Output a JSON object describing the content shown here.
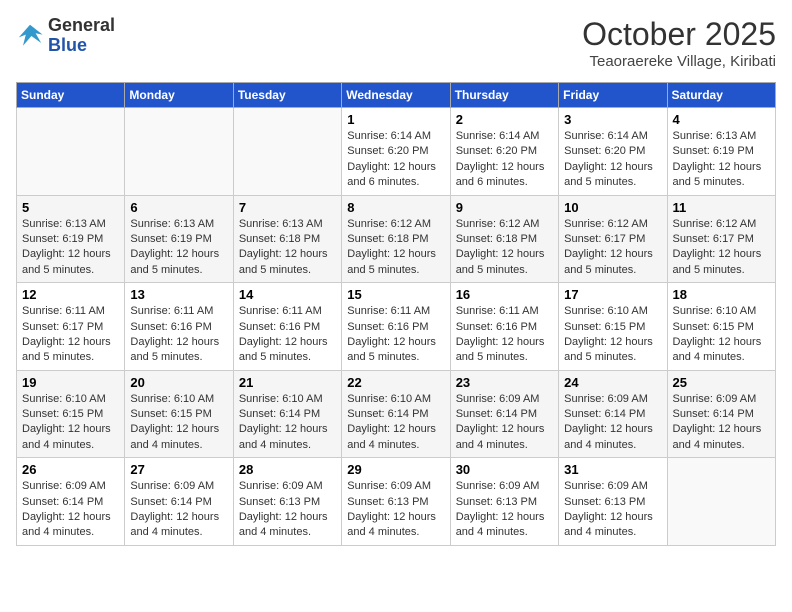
{
  "header": {
    "logo_general": "General",
    "logo_blue": "Blue",
    "month_title": "October 2025",
    "subtitle": "Teaoraereke Village, Kiribati"
  },
  "weekdays": [
    "Sunday",
    "Monday",
    "Tuesday",
    "Wednesday",
    "Thursday",
    "Friday",
    "Saturday"
  ],
  "weeks": [
    [
      {
        "day": "",
        "info": ""
      },
      {
        "day": "",
        "info": ""
      },
      {
        "day": "",
        "info": ""
      },
      {
        "day": "1",
        "info": "Sunrise: 6:14 AM\nSunset: 6:20 PM\nDaylight: 12 hours and 6 minutes."
      },
      {
        "day": "2",
        "info": "Sunrise: 6:14 AM\nSunset: 6:20 PM\nDaylight: 12 hours and 6 minutes."
      },
      {
        "day": "3",
        "info": "Sunrise: 6:14 AM\nSunset: 6:20 PM\nDaylight: 12 hours and 5 minutes."
      },
      {
        "day": "4",
        "info": "Sunrise: 6:13 AM\nSunset: 6:19 PM\nDaylight: 12 hours and 5 minutes."
      }
    ],
    [
      {
        "day": "5",
        "info": "Sunrise: 6:13 AM\nSunset: 6:19 PM\nDaylight: 12 hours and 5 minutes."
      },
      {
        "day": "6",
        "info": "Sunrise: 6:13 AM\nSunset: 6:19 PM\nDaylight: 12 hours and 5 minutes."
      },
      {
        "day": "7",
        "info": "Sunrise: 6:13 AM\nSunset: 6:18 PM\nDaylight: 12 hours and 5 minutes."
      },
      {
        "day": "8",
        "info": "Sunrise: 6:12 AM\nSunset: 6:18 PM\nDaylight: 12 hours and 5 minutes."
      },
      {
        "day": "9",
        "info": "Sunrise: 6:12 AM\nSunset: 6:18 PM\nDaylight: 12 hours and 5 minutes."
      },
      {
        "day": "10",
        "info": "Sunrise: 6:12 AM\nSunset: 6:17 PM\nDaylight: 12 hours and 5 minutes."
      },
      {
        "day": "11",
        "info": "Sunrise: 6:12 AM\nSunset: 6:17 PM\nDaylight: 12 hours and 5 minutes."
      }
    ],
    [
      {
        "day": "12",
        "info": "Sunrise: 6:11 AM\nSunset: 6:17 PM\nDaylight: 12 hours and 5 minutes."
      },
      {
        "day": "13",
        "info": "Sunrise: 6:11 AM\nSunset: 6:16 PM\nDaylight: 12 hours and 5 minutes."
      },
      {
        "day": "14",
        "info": "Sunrise: 6:11 AM\nSunset: 6:16 PM\nDaylight: 12 hours and 5 minutes."
      },
      {
        "day": "15",
        "info": "Sunrise: 6:11 AM\nSunset: 6:16 PM\nDaylight: 12 hours and 5 minutes."
      },
      {
        "day": "16",
        "info": "Sunrise: 6:11 AM\nSunset: 6:16 PM\nDaylight: 12 hours and 5 minutes."
      },
      {
        "day": "17",
        "info": "Sunrise: 6:10 AM\nSunset: 6:15 PM\nDaylight: 12 hours and 5 minutes."
      },
      {
        "day": "18",
        "info": "Sunrise: 6:10 AM\nSunset: 6:15 PM\nDaylight: 12 hours and 4 minutes."
      }
    ],
    [
      {
        "day": "19",
        "info": "Sunrise: 6:10 AM\nSunset: 6:15 PM\nDaylight: 12 hours and 4 minutes."
      },
      {
        "day": "20",
        "info": "Sunrise: 6:10 AM\nSunset: 6:15 PM\nDaylight: 12 hours and 4 minutes."
      },
      {
        "day": "21",
        "info": "Sunrise: 6:10 AM\nSunset: 6:14 PM\nDaylight: 12 hours and 4 minutes."
      },
      {
        "day": "22",
        "info": "Sunrise: 6:10 AM\nSunset: 6:14 PM\nDaylight: 12 hours and 4 minutes."
      },
      {
        "day": "23",
        "info": "Sunrise: 6:09 AM\nSunset: 6:14 PM\nDaylight: 12 hours and 4 minutes."
      },
      {
        "day": "24",
        "info": "Sunrise: 6:09 AM\nSunset: 6:14 PM\nDaylight: 12 hours and 4 minutes."
      },
      {
        "day": "25",
        "info": "Sunrise: 6:09 AM\nSunset: 6:14 PM\nDaylight: 12 hours and 4 minutes."
      }
    ],
    [
      {
        "day": "26",
        "info": "Sunrise: 6:09 AM\nSunset: 6:14 PM\nDaylight: 12 hours and 4 minutes."
      },
      {
        "day": "27",
        "info": "Sunrise: 6:09 AM\nSunset: 6:14 PM\nDaylight: 12 hours and 4 minutes."
      },
      {
        "day": "28",
        "info": "Sunrise: 6:09 AM\nSunset: 6:13 PM\nDaylight: 12 hours and 4 minutes."
      },
      {
        "day": "29",
        "info": "Sunrise: 6:09 AM\nSunset: 6:13 PM\nDaylight: 12 hours and 4 minutes."
      },
      {
        "day": "30",
        "info": "Sunrise: 6:09 AM\nSunset: 6:13 PM\nDaylight: 12 hours and 4 minutes."
      },
      {
        "day": "31",
        "info": "Sunrise: 6:09 AM\nSunset: 6:13 PM\nDaylight: 12 hours and 4 minutes."
      },
      {
        "day": "",
        "info": ""
      }
    ]
  ]
}
